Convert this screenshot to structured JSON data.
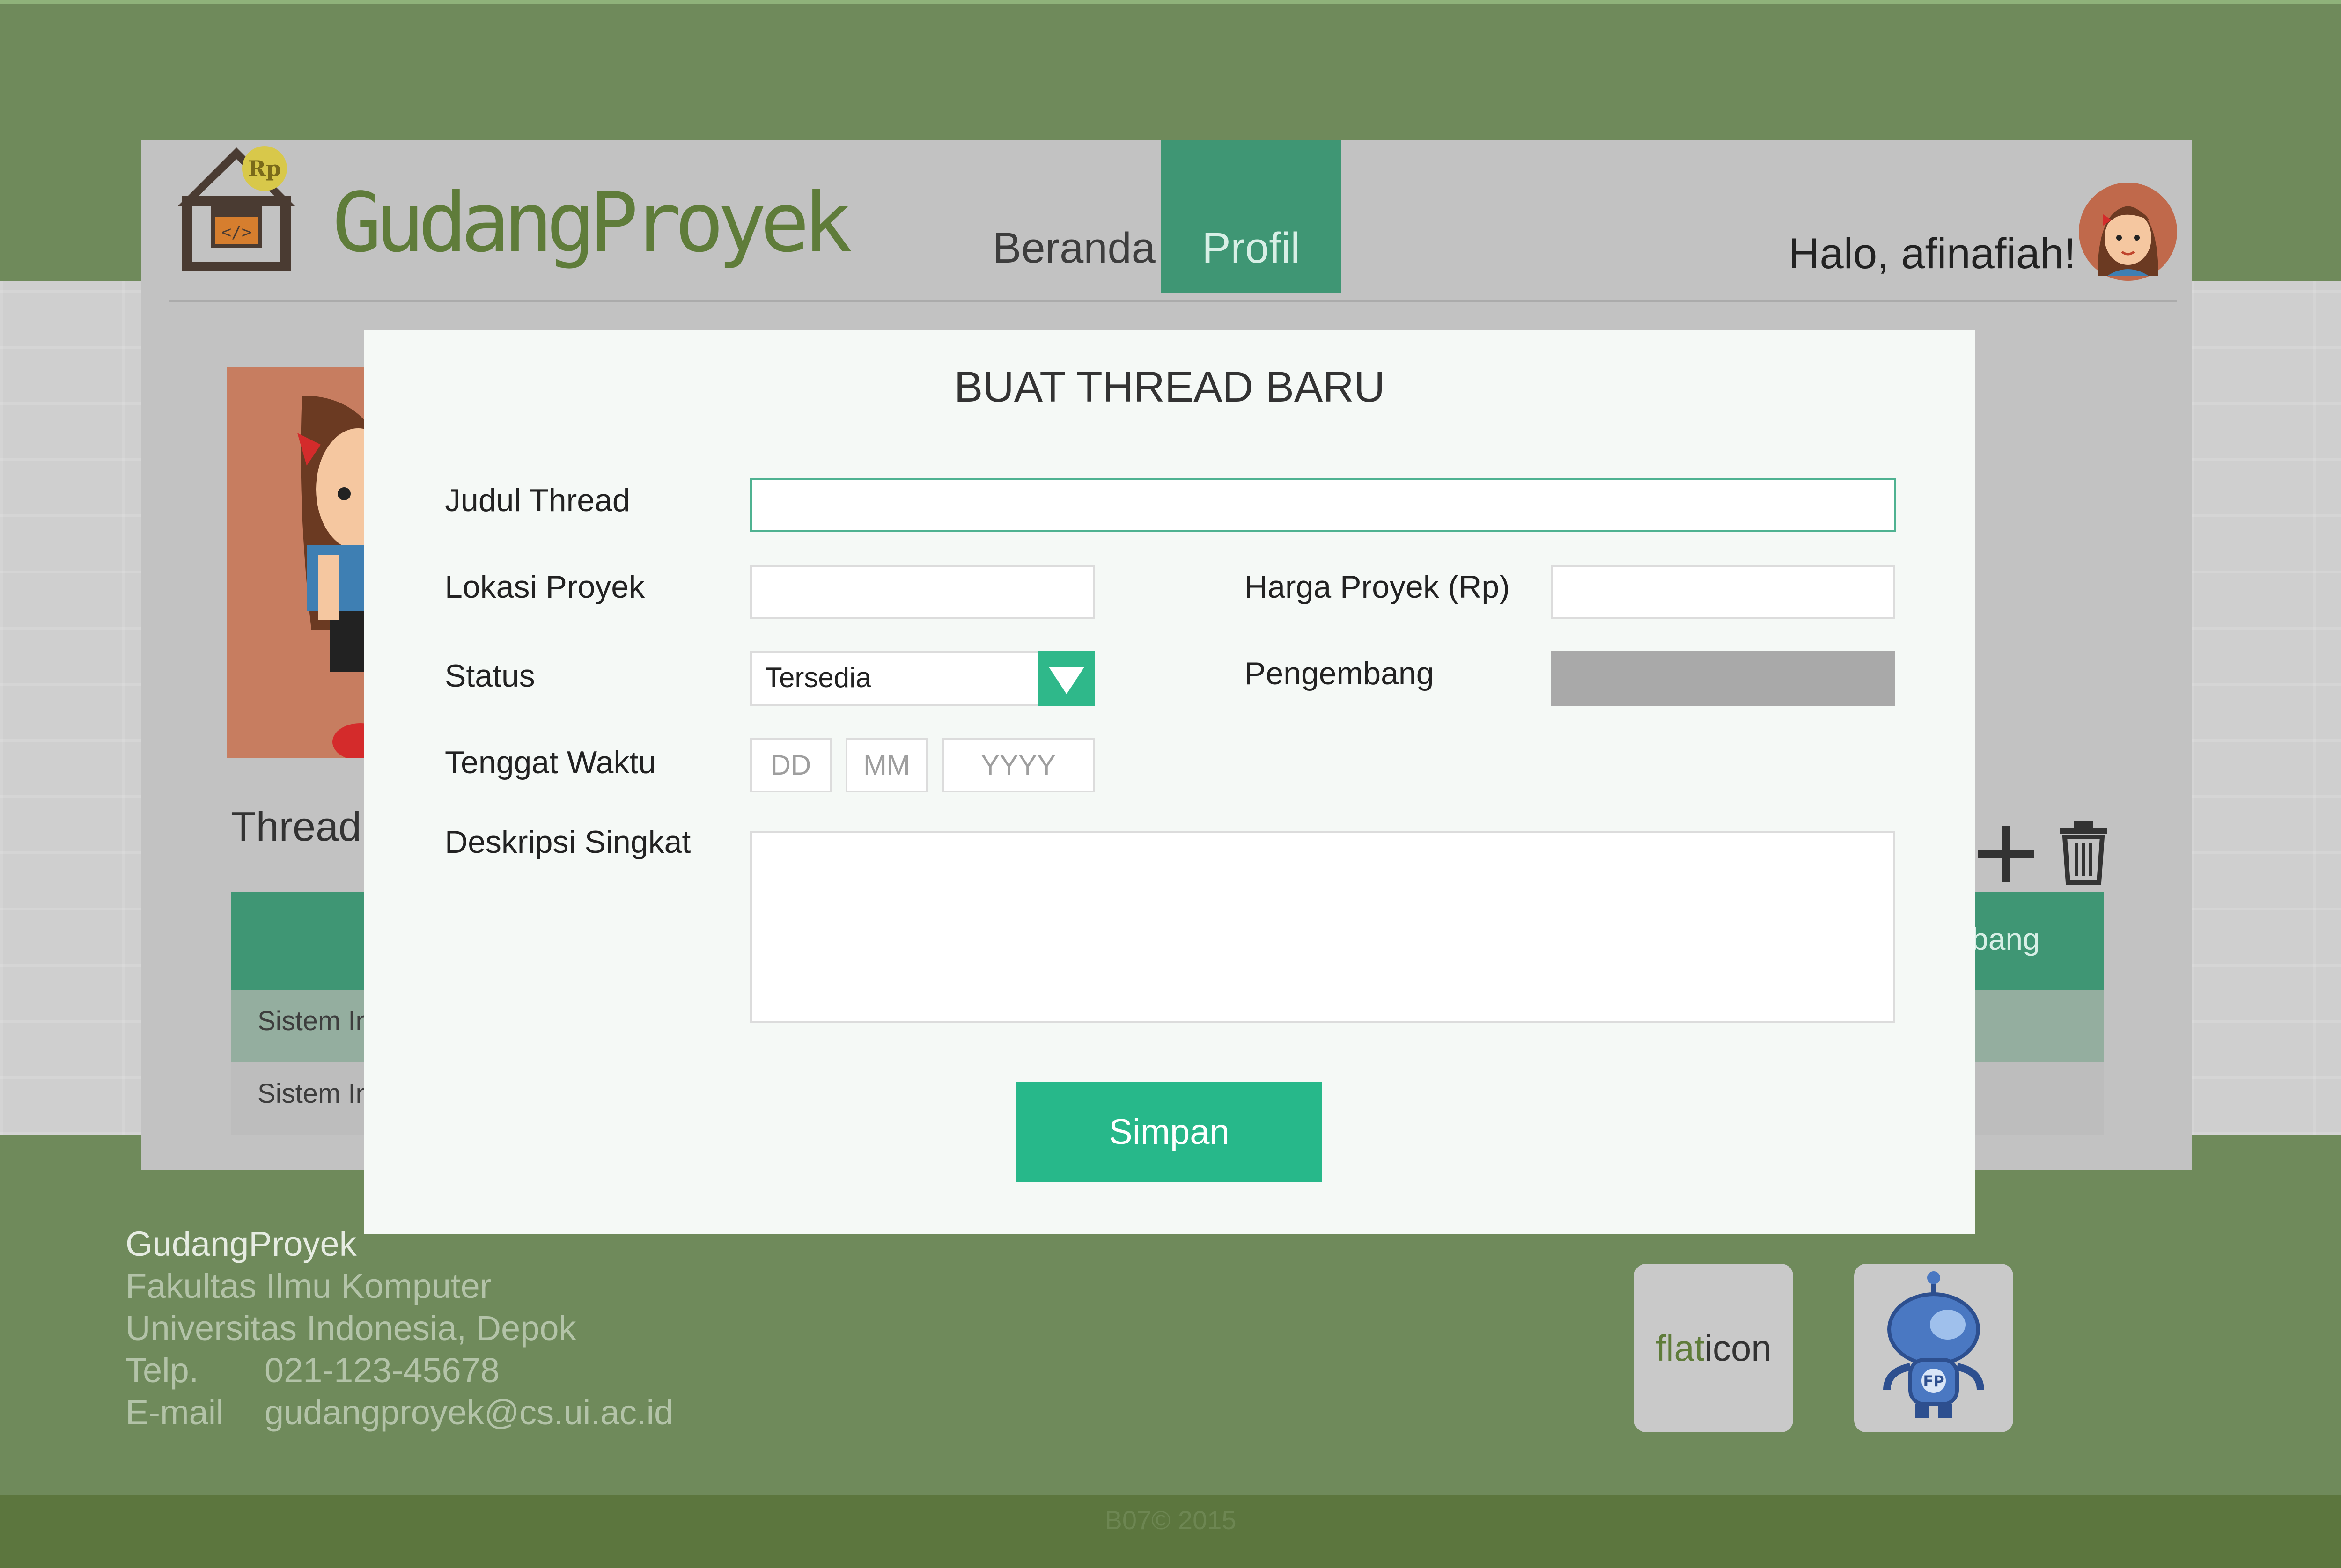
{
  "app": {
    "brand": "GudangProyek",
    "logo_badge": "Rp"
  },
  "nav": {
    "beranda": "Beranda",
    "profil": "Profil"
  },
  "user": {
    "greeting": "Halo, afinafiah!"
  },
  "profile": {
    "thread_heading": "Thread",
    "table_header_partial": "bang",
    "rows": [
      "Sistem In",
      "Sistem In"
    ]
  },
  "modal": {
    "title": "BUAT THREAD BARU",
    "judul_label": "Judul Thread",
    "judul_value": "",
    "lokasi_label": "Lokasi Proyek",
    "lokasi_value": "",
    "harga_label": "Harga Proyek (Rp)",
    "harga_value": "",
    "status_label": "Status",
    "status_value": "Tersedia",
    "pengembang_label": "Pengembang",
    "tenggat_label": "Tenggat Waktu",
    "date_dd": "DD",
    "date_mm": "MM",
    "date_yyyy": "YYYY",
    "deskripsi_label": "Deskripsi Singkat",
    "deskripsi_value": "",
    "submit_label": "Simpan"
  },
  "footer": {
    "title": "GudangProyek",
    "line1": "Fakultas Ilmu Komputer",
    "line2": "Universitas Indonesia, Depok",
    "telp_label": "Telp.",
    "telp_value": "021-123-45678",
    "email_label": "E-mail",
    "email_value": "gudangproyek@cs.ui.ac.id",
    "flaticon_a": "flat",
    "flaticon_b": "icon",
    "fp_badge": "FP",
    "copyright": "B07© 2015"
  },
  "colors": {
    "page_green": "#6f8a5b",
    "accent_teal": "#3f9674",
    "button_green": "#27b88a",
    "brand_green": "#5f7c3a"
  },
  "icons": [
    "house-logo-icon",
    "avatar-icon",
    "plus-icon",
    "trash-icon",
    "dropdown-arrow-icon",
    "robot-fp-icon"
  ]
}
